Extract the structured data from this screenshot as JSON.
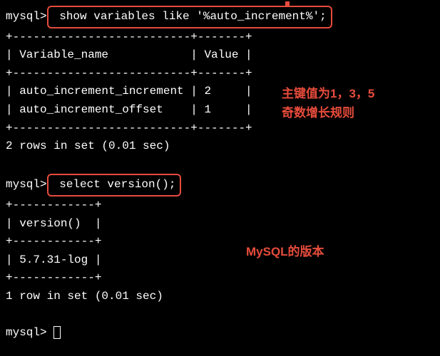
{
  "line1_prompt": "mysql>",
  "line1_cmd": " show variables like '%auto_increment%';",
  "sep_top": "+--------------------------+-------+",
  "header_row": "| Variable_name            | Value |",
  "sep_mid": "+--------------------------+-------+",
  "row1": "| auto_increment_increment | 2     |",
  "row2": "| auto_increment_offset    | 1     |",
  "sep_bot": "+--------------------------+-------+",
  "result1": "2 rows in set (0.01 sec)",
  "line2_prompt": "mysql>",
  "line2_cmd": " select version();",
  "vsep_top": "+------------+",
  "vheader": "| version()  |",
  "vsep_mid": "+------------+",
  "vrow": "| 5.7.31-log |",
  "vsep_bot": "+------------+",
  "result2": "1 row in set (0.01 sec)",
  "line3_prompt": "mysql> ",
  "annotation1_line1": "主键值为1，3，5",
  "annotation1_line2": "奇数增长规则",
  "annotation2": "MySQL的版本"
}
